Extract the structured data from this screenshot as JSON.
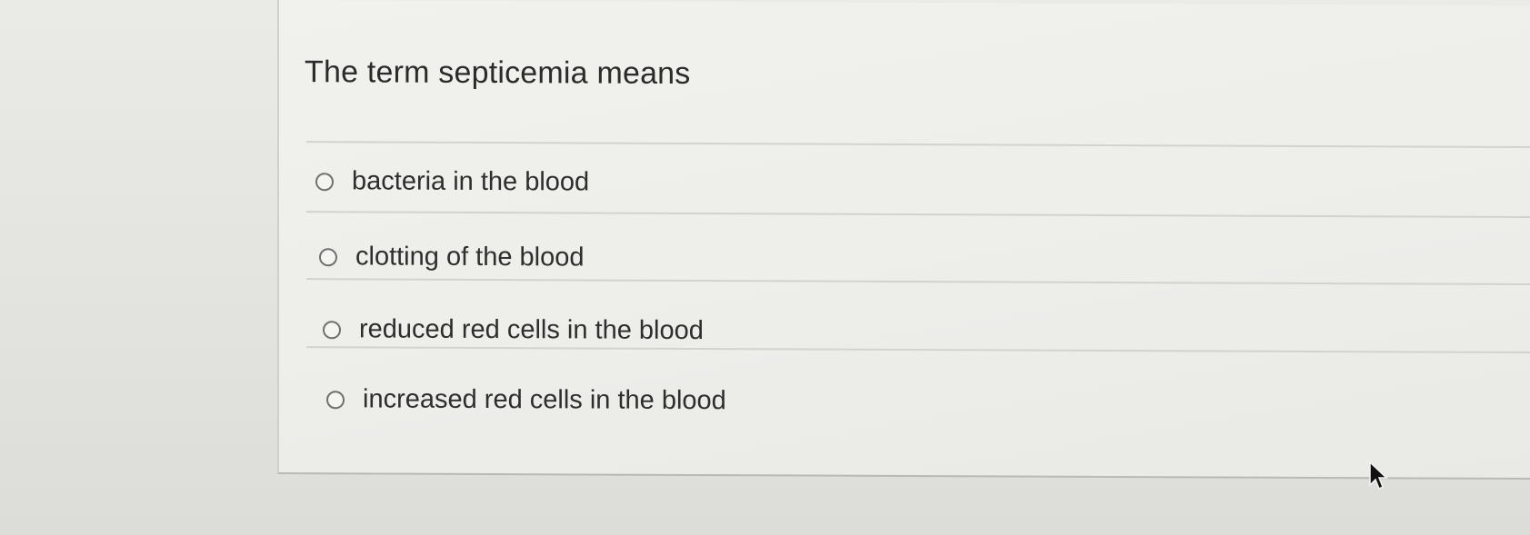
{
  "question": {
    "text": "The term septicemia means"
  },
  "answers": [
    {
      "label": "bacteria in the blood",
      "selected": false
    },
    {
      "label": "clotting of the blood",
      "selected": false
    },
    {
      "label": "reduced red cells in the blood",
      "selected": false
    },
    {
      "label": "increased red cells in the blood",
      "selected": false
    }
  ],
  "icons": {
    "radio": "radio-button-icon",
    "cursor": "mouse-pointer-icon"
  },
  "colors": {
    "card_background": "#efefeb",
    "text": "#2b2b2b",
    "radio_border": "#6f6f6f",
    "divider": "#d2d2ce"
  }
}
